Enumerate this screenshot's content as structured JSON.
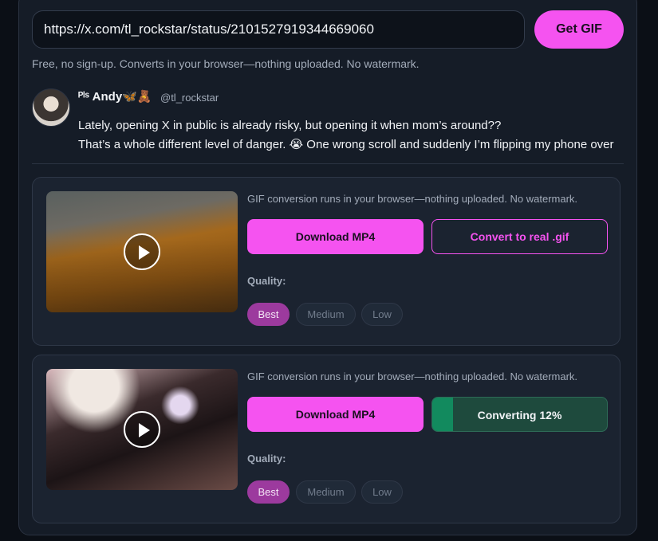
{
  "url_input": {
    "value": "https://x.com/tl_rockstar/status/2101527919344669060"
  },
  "get_gif_label": "Get GIF",
  "privacy_note": "Free, no sign-up. Converts in your browser—nothing uploaded. No watermark.",
  "tweet": {
    "author_name": "ᴾˡˢ Andy🦋🧸",
    "author_handle": "@tl_rockstar",
    "lines": [
      "Lately, opening X in public is already risky, but opening it when mom’s around??",
      "That’s a whole different level of danger. 😭 One wrong scroll and suddenly I’m flipping my phone over"
    ]
  },
  "media": [
    {
      "note": "GIF conversion runs in your browser—nothing uploaded. No watermark.",
      "download_label": "Download MP4",
      "convert_label": "Convert to real .gif",
      "quality_label": "Quality:",
      "quality_options": [
        "Best",
        "Medium",
        "Low"
      ],
      "selected_quality": "Best"
    },
    {
      "note": "GIF conversion runs in your browser—nothing uploaded. No watermark.",
      "download_label": "Download MP4",
      "progress_label": "Converting 12%",
      "progress_fraction": 0.12,
      "quality_label": "Quality:",
      "quality_options": [
        "Best",
        "Medium",
        "Low"
      ],
      "selected_quality": "Best"
    }
  ],
  "colors": {
    "accent": "#f553f0",
    "progress_fill": "#128a5e",
    "progress_track": "#1e4a3d",
    "active_quality": "#9c3a9e"
  }
}
